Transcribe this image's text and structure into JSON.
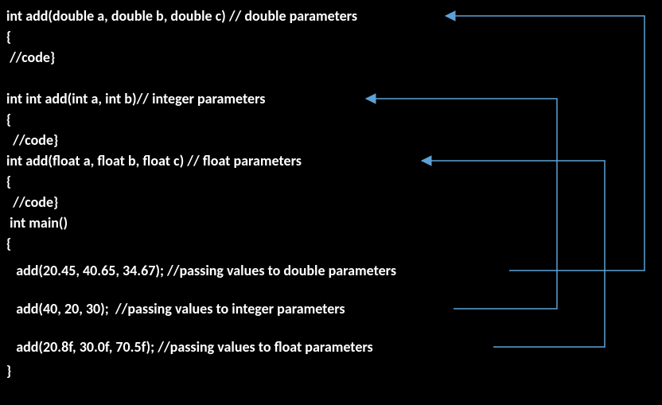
{
  "lines": {
    "l1": "int add(double a, double b, double c) // double parameters",
    "l2": "{",
    "l3": " //code}",
    "l4": "int int add(int a, int b)// integer parameters",
    "l5": "{",
    "l6": "  //code}",
    "l7": "int add(float a, float b, float c) // float parameters",
    "l8": "{",
    "l9": "  //code}",
    "l10": " int main()",
    "l11": "{",
    "l12": "   add(20.45, 40.65, 34.67); //passing values to double parameters",
    "l13": "   add(40, 20, 30);  //passing values to integer parameters",
    "l14": "   add(20.8f, 30.0f, 70.5f); //passing values to float parameters",
    "l15": "}"
  },
  "arrows": {
    "arrow1": {
      "from": "call-double",
      "to": "decl-double"
    },
    "arrow2": {
      "from": "call-integer",
      "to": "decl-integer"
    },
    "arrow3": {
      "from": "call-float",
      "to": "decl-float"
    }
  },
  "colors": {
    "background": "#000000",
    "text": "#FFFFFF",
    "arrow": "#5da2d5"
  }
}
